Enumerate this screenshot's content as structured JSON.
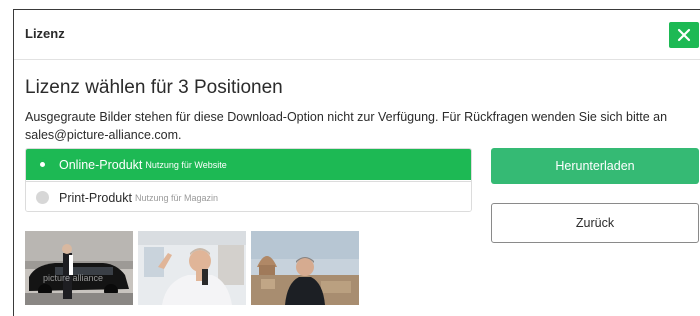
{
  "colors": {
    "accent": "#1db954",
    "button_green": "#35ba74",
    "text": "#2b2b2b",
    "muted": "#8a8a8a"
  },
  "dialog": {
    "title": "Lizenz",
    "close_icon": "close-icon"
  },
  "heading": "Lizenz wählen für 3 Positionen",
  "notice": "Ausgegraute Bilder stehen für diese Download-Option nicht zur Verfügung. Für Rückfragen wenden Sie sich bitte an sales@picture-alliance.com.",
  "license_options": [
    {
      "name": "Online-Produkt",
      "description": "Nutzung für Website",
      "selected": true
    },
    {
      "name": "Print-Produkt",
      "description": "Nutzung für Magazin",
      "selected": false
    }
  ],
  "buttons": {
    "download": "Herunterladen",
    "back": "Zurück"
  },
  "thumbnails": [
    {
      "name": "thumbnail-car-scene",
      "watermark": "picture alliance"
    },
    {
      "name": "thumbnail-speaker-scene"
    },
    {
      "name": "thumbnail-city-scene"
    }
  ]
}
